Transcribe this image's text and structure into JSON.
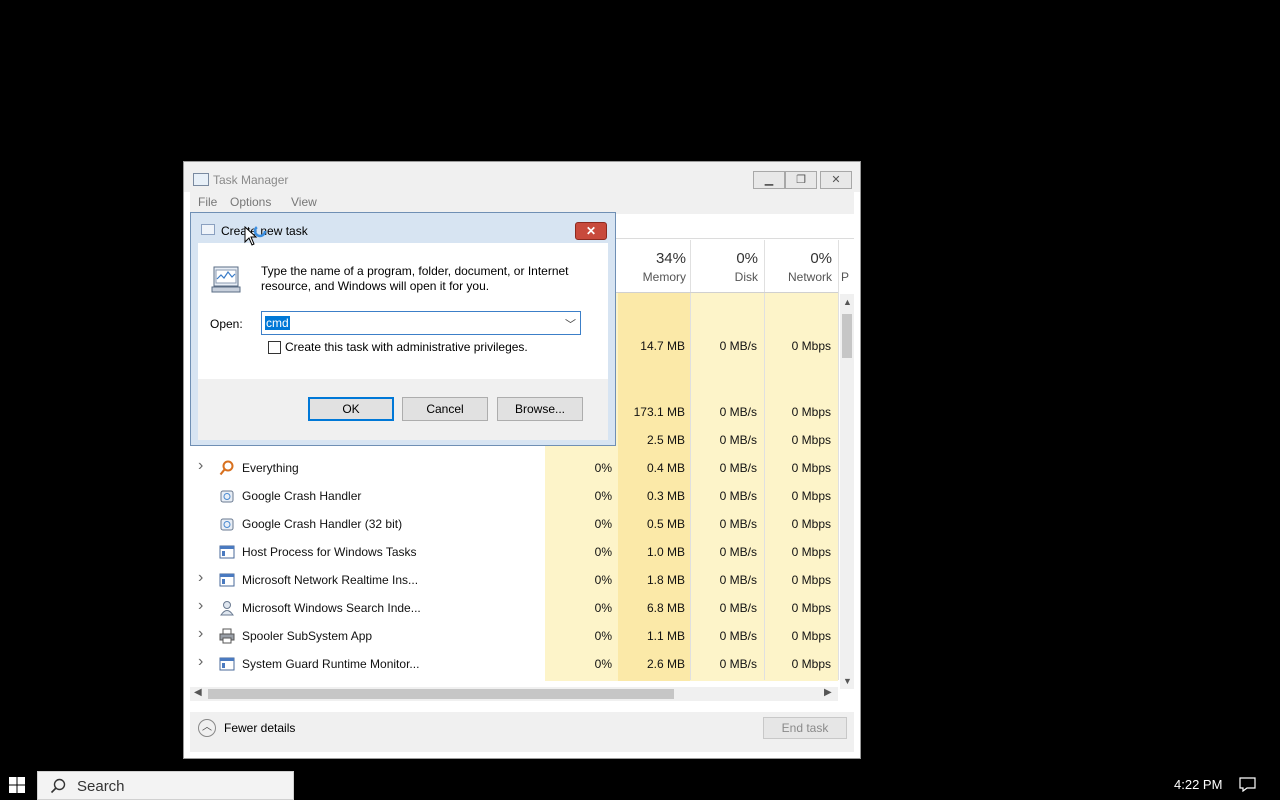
{
  "task_manager": {
    "title": "Task Manager",
    "menu": [
      "File",
      "Options",
      "View"
    ],
    "columns": [
      {
        "pct": "34%",
        "label": "Memory"
      },
      {
        "pct": "0%",
        "label": "Disk"
      },
      {
        "pct": "0%",
        "label": "Network"
      },
      {
        "pct": "",
        "label": "P"
      }
    ],
    "rows_partial": [
      {
        "memory": "14.7 MB",
        "disk": "0 MB/s",
        "network": "0 Mbps"
      },
      {
        "memory": "173.1 MB",
        "disk": "0 MB/s",
        "network": "0 Mbps"
      },
      {
        "memory": "2.5 MB",
        "disk": "0 MB/s",
        "network": "0 Mbps"
      }
    ],
    "rows": [
      {
        "name": "Everything",
        "icon": "magnifier-key-icon",
        "expand": true,
        "cpu": "0%",
        "memory": "0.4 MB",
        "disk": "0 MB/s",
        "network": "0 Mbps"
      },
      {
        "name": "Google Crash Handler",
        "icon": "crash-handler-icon",
        "expand": false,
        "cpu": "0%",
        "memory": "0.3 MB",
        "disk": "0 MB/s",
        "network": "0 Mbps"
      },
      {
        "name": "Google Crash Handler (32 bit)",
        "icon": "crash-handler-icon",
        "expand": false,
        "cpu": "0%",
        "memory": "0.5 MB",
        "disk": "0 MB/s",
        "network": "0 Mbps"
      },
      {
        "name": "Host Process for Windows Tasks",
        "icon": "app-window-icon",
        "expand": false,
        "cpu": "0%",
        "memory": "1.0 MB",
        "disk": "0 MB/s",
        "network": "0 Mbps"
      },
      {
        "name": "Microsoft Network Realtime Ins...",
        "icon": "app-window-icon",
        "expand": true,
        "cpu": "0%",
        "memory": "1.8 MB",
        "disk": "0 MB/s",
        "network": "0 Mbps"
      },
      {
        "name": "Microsoft Windows Search Inde...",
        "icon": "search-indexer-icon",
        "expand": true,
        "cpu": "0%",
        "memory": "6.8 MB",
        "disk": "0 MB/s",
        "network": "0 Mbps"
      },
      {
        "name": "Spooler SubSystem App",
        "icon": "printer-icon",
        "expand": true,
        "cpu": "0%",
        "memory": "1.1 MB",
        "disk": "0 MB/s",
        "network": "0 Mbps"
      },
      {
        "name": "System Guard Runtime Monitor...",
        "icon": "app-window-icon",
        "expand": true,
        "cpu": "0%",
        "memory": "2.6 MB",
        "disk": "0 MB/s",
        "network": "0 Mbps"
      }
    ],
    "footer": {
      "fewer_details": "Fewer details",
      "end_task": "End task"
    }
  },
  "dialog": {
    "title": "Create new task",
    "description": "Type the name of a program, folder, document, or Internet resource, and Windows will open it for you.",
    "open_label": "Open:",
    "open_value": "cmd",
    "admin_label": "Create this task with administrative privileges.",
    "ok": "OK",
    "cancel": "Cancel",
    "browse": "Browse...",
    "close": "✕"
  },
  "taskbar": {
    "search_placeholder": "Search",
    "time": "4:22 PM"
  },
  "colors": {
    "selection": "#0078d7",
    "memory_heat": "#fbe9a8",
    "cpu_heat": "#fdf4c9",
    "dialog_frame": "#d7e4f2"
  }
}
